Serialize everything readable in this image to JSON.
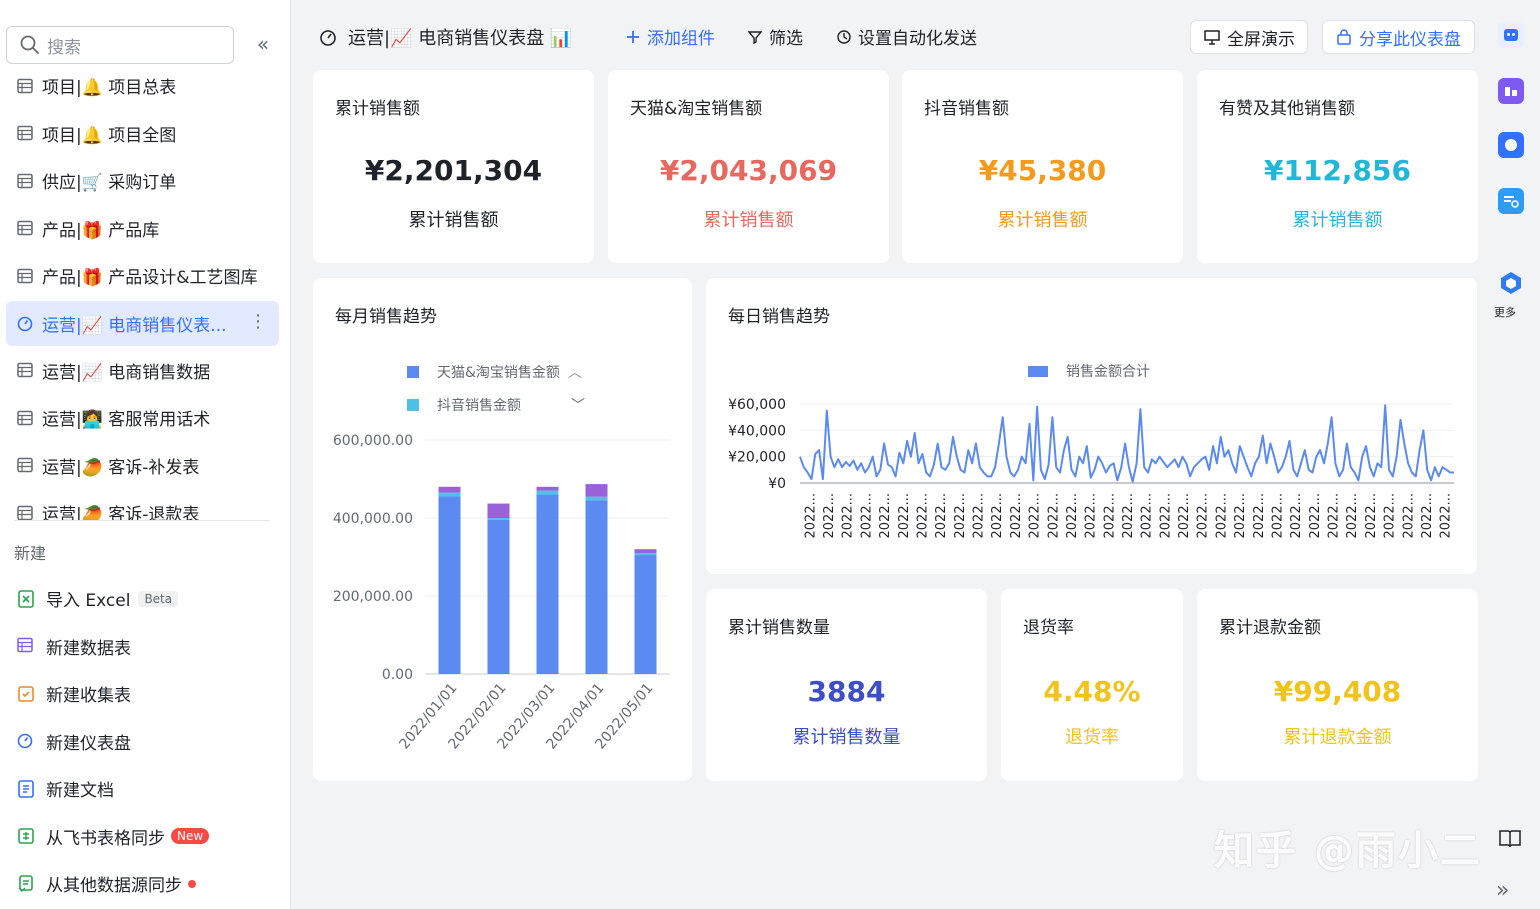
{
  "sidebar": {
    "search_placeholder": "搜索",
    "collapse_label": "«",
    "items": [
      {
        "label": "项目|🔔 项目总表",
        "icon": "table-icon"
      },
      {
        "label": "项目|🔔 项目全图",
        "icon": "table-icon"
      },
      {
        "label": "供应|🛒 采购订单",
        "icon": "table-icon"
      },
      {
        "label": "产品|🎁 产品库",
        "icon": "table-icon"
      },
      {
        "label": "产品|🎁 产品设计&工艺图库",
        "icon": "table-icon"
      },
      {
        "label": "运营|📈 电商销售仪表...",
        "icon": "dashboard-icon",
        "active": true,
        "more": "⋮"
      },
      {
        "label": "运营|📈 电商销售数据",
        "icon": "table-icon"
      },
      {
        "label": "运营|👩‍💻 客服常用话术",
        "icon": "table-icon"
      },
      {
        "label": "运营|🥭 客诉-补发表",
        "icon": "table-icon"
      },
      {
        "label": "运营|🥭 客诉-退款表",
        "icon": "table-icon"
      }
    ],
    "new_section_label": "新建",
    "new_items": [
      {
        "label": "导入 Excel",
        "icon": "excel-icon",
        "badge": "Beta"
      },
      {
        "label": "新建数据表",
        "icon": "table-icon"
      },
      {
        "label": "新建收集表",
        "icon": "form-icon"
      },
      {
        "label": "新建仪表盘",
        "icon": "dashboard-icon"
      },
      {
        "label": "新建文档",
        "icon": "doc-icon"
      },
      {
        "label": "从飞书表格同步",
        "icon": "sheet-sync-icon",
        "badge": "New"
      },
      {
        "label": "从其他数据源同步",
        "icon": "datasource-sync-icon",
        "dot": true
      }
    ]
  },
  "toolbar": {
    "title": "运营|📈 电商销售仪表盘 📊",
    "add_widget": "添加组件",
    "filter": "筛选",
    "automation": "设置自动化发送",
    "fullscreen": "全屏演示",
    "share": "分享此仪表盘"
  },
  "rail": {
    "more_label": "更多"
  },
  "kpis": [
    {
      "title": "累计销售额",
      "value": "¥2,201,304",
      "sub": "累计销售额",
      "color": "#1f2329"
    },
    {
      "title": "天猫&淘宝销售额",
      "value": "¥2,043,069",
      "sub": "累计销售额",
      "color": "#e8685f"
    },
    {
      "title": "抖音销售额",
      "value": "¥45,380",
      "sub": "累计销售额",
      "color": "#f59a1b"
    },
    {
      "title": "有赞及其他销售额",
      "value": "¥112,856",
      "sub": "累计销售额",
      "color": "#1fb8d8"
    }
  ],
  "kpis2": [
    {
      "title": "累计销售数量",
      "value": "3884",
      "sub": "累计销售数量",
      "color": "#3d4ec6"
    },
    {
      "title": "退货率",
      "value": "4.48%",
      "sub": "退货率",
      "color": "#f2c31a"
    },
    {
      "title": "累计退款金额",
      "value": "¥99,408",
      "sub": "累计退款金额",
      "color": "#f2c31a"
    }
  ],
  "monthly_card_title": "每月销售趋势",
  "daily_card_title": "每日销售趋势",
  "chart_data": [
    {
      "type": "bar",
      "stacked": true,
      "categories": [
        "2022/01/01",
        "2022/02/01",
        "2022/03/01",
        "2022/04/01",
        "2022/05/01"
      ],
      "series": [
        {
          "name": "天猫&淘宝销售金额",
          "color": "#5b8af0",
          "values": [
            455000,
            395000,
            460000,
            445000,
            305000
          ]
        },
        {
          "name": "抖音销售金额",
          "color": "#4fc1e9",
          "values": [
            10000,
            5000,
            10000,
            10000,
            5000
          ]
        },
        {
          "name": "",
          "color": "#9a62d8",
          "values": [
            15000,
            37000,
            10000,
            32000,
            10000
          ]
        }
      ],
      "legend_visible": [
        "天猫&淘宝销售金额",
        "抖音销售金额"
      ],
      "yticks": [
        "600,000.00",
        "400,000.00",
        "200,000.00",
        "0.00"
      ],
      "ylim": [
        0,
        600000
      ],
      "grid": true,
      "legend_position": "top"
    },
    {
      "type": "line",
      "series": [
        {
          "name": "销售金额合计",
          "color": "#5b8af0",
          "values": [
            20000,
            12000,
            8000,
            3000,
            22000,
            25000,
            3000,
            55000,
            20000,
            12000,
            18000,
            12000,
            16000,
            13000,
            17000,
            10000,
            15000,
            8000,
            12000,
            20000,
            5000,
            10000,
            30000,
            14000,
            12000,
            5000,
            23000,
            15000,
            32000,
            20000,
            38000,
            15000,
            22000,
            8000,
            5000,
            14000,
            30000,
            12000,
            10000,
            15000,
            35000,
            20000,
            10000,
            8000,
            25000,
            15000,
            30000,
            12000,
            8000,
            5000,
            5000,
            12000,
            30000,
            50000,
            20000,
            8000,
            5000,
            10000,
            20000,
            15000,
            45000,
            2000,
            58000,
            10000,
            3000,
            14000,
            50000,
            12000,
            8000,
            25000,
            35000,
            10000,
            5000,
            20000,
            15000,
            28000,
            4000,
            10000,
            20000,
            15000,
            8000,
            13000,
            15000,
            2000,
            12000,
            30000,
            12000,
            1000,
            15000,
            56000,
            12000,
            8000,
            18000,
            15000,
            20000,
            16000,
            12000,
            15000,
            18000,
            12000,
            20000,
            15000,
            5000,
            12000,
            15000,
            18000,
            20000,
            10000,
            28000,
            15000,
            35000,
            20000,
            25000,
            15000,
            8000,
            28000,
            20000,
            12000,
            5000,
            15000,
            20000,
            36000,
            15000,
            30000,
            20000,
            8000,
            12000,
            20000,
            32000,
            10000,
            5000,
            15000,
            25000,
            10000,
            8000,
            20000,
            25000,
            15000,
            30000,
            50000,
            15000,
            5000,
            10000,
            30000,
            12000,
            8000,
            2000,
            20000,
            28000,
            12000,
            5000,
            15000,
            12000,
            59000,
            10000,
            5000,
            20000,
            48000,
            30000,
            15000,
            8000,
            5000,
            25000,
            40000,
            10000,
            2000,
            12000,
            5000,
            12000,
            10000,
            8000,
            8000
          ]
        }
      ],
      "yticks": [
        "¥60,000",
        "¥40,000",
        "¥20,000",
        "¥0"
      ],
      "ylim": [
        0,
        60000
      ],
      "xtick_label": "2022...",
      "xtick_count": 35,
      "grid": true,
      "legend_position": "top"
    }
  ],
  "watermark": "知乎 @雨小二",
  "expand_label": "»"
}
